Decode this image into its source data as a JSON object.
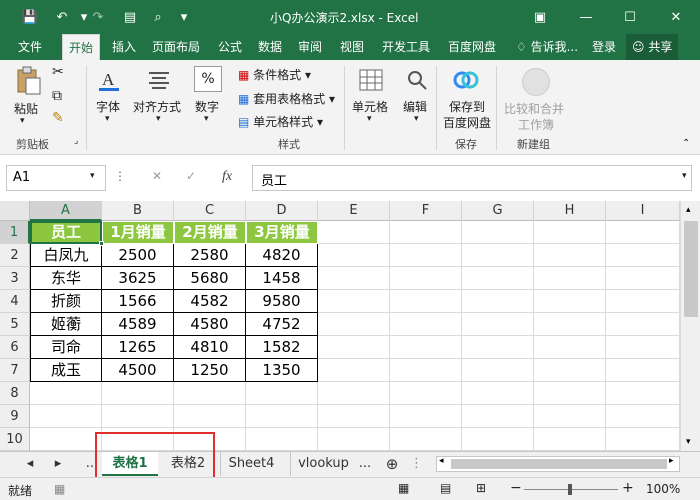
{
  "window": {
    "title": "小Q办公演示2.xlsx - Excel",
    "min_icon": "—",
    "restore_icon": "☐",
    "close_icon": "✕",
    "ribbon_options_icon": "▣"
  },
  "qat": {
    "save_icon": "💾",
    "undo_icon": "↶",
    "redo_icon": "↷",
    "new_icon": "▤",
    "preview_icon": "⌕",
    "more_icon": "▾"
  },
  "ribbon_tabs": [
    "文件",
    "开始",
    "插入",
    "页面布局",
    "公式",
    "数据",
    "审阅",
    "视图",
    "开发工具",
    "百度网盘"
  ],
  "ribbon_right": {
    "tell_me": "告诉我...",
    "login": "登录",
    "share": "共享"
  },
  "ribbon": {
    "paste": "粘贴",
    "clipboard_group": "剪贴板",
    "font": "字体",
    "alignment": "对齐方式",
    "number": "数字",
    "number_icon": "%",
    "conditional_format": "条件格式",
    "table_format": "套用表格格式",
    "cell_style": "单元格样式",
    "styles_group": "样式",
    "cells": "单元格",
    "editing": "编辑",
    "save_baidu_1": "保存到",
    "save_baidu_2": "百度网盘",
    "save_group": "保存",
    "compare_1": "比较和合并",
    "compare_2": "工作簿",
    "new_group": "新建组"
  },
  "formula_bar": {
    "name_box": "A1",
    "cancel_icon": "✕",
    "enter_icon": "✓",
    "fx_icon": "fx",
    "content": "员工"
  },
  "columns": [
    "A",
    "B",
    "C",
    "D",
    "E",
    "F",
    "G",
    "H",
    "I"
  ],
  "rows": [
    "1",
    "2",
    "3",
    "4",
    "5",
    "6",
    "7",
    "8",
    "9",
    "10"
  ],
  "table": {
    "headers": [
      "员工",
      "1月销量",
      "2月销量",
      "3月销量"
    ],
    "rows": [
      [
        "白凤九",
        "2500",
        "2580",
        "4820"
      ],
      [
        "东华",
        "3625",
        "5680",
        "1458"
      ],
      [
        "折颜",
        "1566",
        "4582",
        "9580"
      ],
      [
        "姬蘅",
        "4589",
        "4580",
        "4752"
      ],
      [
        "司命",
        "1265",
        "4810",
        "1582"
      ],
      [
        "成玉",
        "4500",
        "1250",
        "1350"
      ]
    ]
  },
  "sheet_tabs": [
    "表格1",
    "表格2",
    "Sheet4",
    "vlookup",
    "..."
  ],
  "sheet_nav": {
    "prev": "◂",
    "next": "▸",
    "add": "⊕",
    "more": "..."
  },
  "status": {
    "ready": "就绪",
    "zoom": "100%",
    "zoom_out": "−",
    "zoom_in": "+"
  },
  "colors": {
    "excel_green": "#217346",
    "header_green": "#8dc63f",
    "highlight_red": "#e0302d"
  }
}
